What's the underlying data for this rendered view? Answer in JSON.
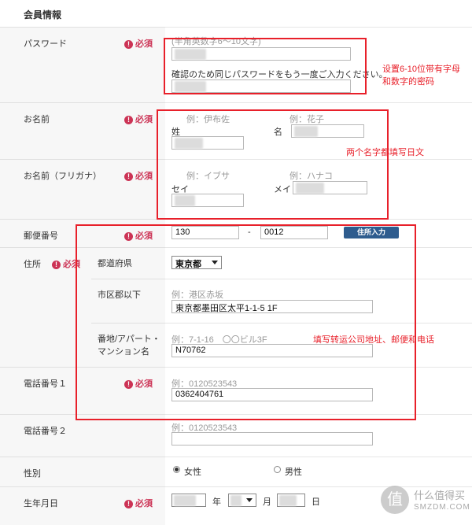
{
  "section_title": "会員情報",
  "required_label": "必須",
  "required_mark": "!",
  "password": {
    "label": "パスワード",
    "hint": "(半角英数字6〜10文字)",
    "confirm_text": "確認のため同じパスワードをもう一度ご入力ください。"
  },
  "name": {
    "label": "お名前",
    "sei_example": "例：伊布佐",
    "mei_example": "例：花子",
    "sei_label": "姓",
    "mei_label": "名"
  },
  "kana": {
    "label": "お名前（フリガナ）",
    "sei_example": "例：イブサ",
    "mei_example": "例：ハナコ",
    "sei_label": "セイ",
    "mei_label": "メイ"
  },
  "postal": {
    "label": "郵便番号",
    "part1": "130",
    "dash": "-",
    "part2": "0012",
    "button": "住所入力"
  },
  "address": {
    "label": "住所",
    "prefecture_label": "都道府県",
    "prefecture_value": "東京都",
    "city_label": "市区郡以下",
    "city_example": "例：港区赤坂",
    "city_value": "東京都墨田区太平1-1-5 1F",
    "street_label_1": "番地/アパート・",
    "street_label_2": "マンション名",
    "street_example": "例：7-1-16　〇〇ビル3F",
    "street_value": "N70762"
  },
  "phone1": {
    "label": "電話番号１",
    "example": "例：0120523543",
    "value": "0362404761"
  },
  "phone2": {
    "label": "電話番号２",
    "example": "例：0120523543"
  },
  "gender": {
    "label": "性別",
    "female": "女性",
    "male": "男性"
  },
  "birthday": {
    "label": "生年月日",
    "year": "年",
    "month": "月",
    "day": "日"
  },
  "annotations": {
    "password_note_1": "设置6-10位带有字母",
    "password_note_2": "和数字的密码",
    "name_note": "两个名字都填写日文",
    "address_note": "填写转运公司地址、邮便和电话"
  },
  "watermark": {
    "symbol": "值",
    "line1": "什么值得买",
    "line2": "SMZDM.COM"
  },
  "colors": {
    "accent_red": "#e8202a",
    "required": "#cc3355",
    "button": "#2e5c8e"
  }
}
